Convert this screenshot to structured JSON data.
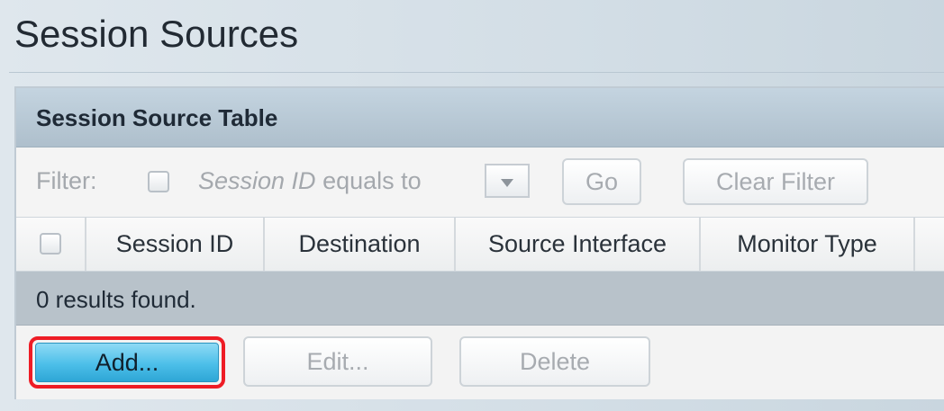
{
  "page": {
    "title": "Session Sources"
  },
  "table": {
    "title": "Session Source Table",
    "filter": {
      "label": "Filter:",
      "condition_field": "Session ID",
      "condition_op": " equals to",
      "go_label": "Go",
      "clear_label": "Clear Filter"
    },
    "columns": [
      "Session ID",
      "Destination",
      "Source Interface",
      "Monitor Type"
    ],
    "rows": [],
    "results_text": "0 results found."
  },
  "actions": {
    "add_label": "Add...",
    "edit_label": "Edit...",
    "delete_label": "Delete"
  },
  "colors": {
    "highlight": "#ee1c25",
    "primary_button": "#4cbfe9",
    "header_band": "#aebfcc",
    "results_band": "#b8c2ca"
  }
}
